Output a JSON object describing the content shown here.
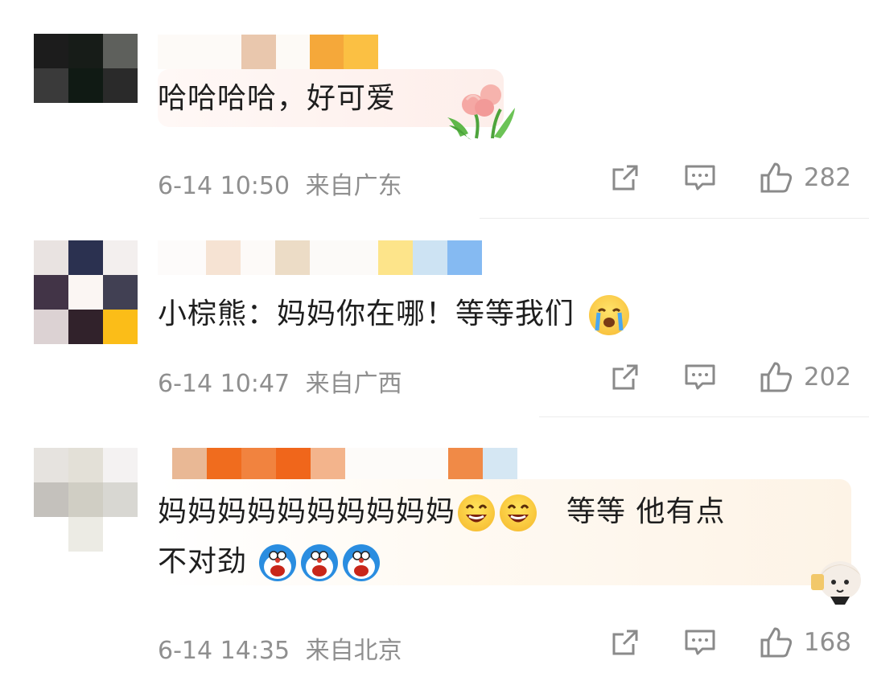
{
  "comments": [
    {
      "text": "哈哈哈哈，好可爱",
      "date": "6-14 10:50",
      "location": "来自广东",
      "likes": "282",
      "sticker": "tulip-sticker"
    },
    {
      "text": "小棕熊：妈妈你在哪！等等我们",
      "date": "6-14 10:47",
      "location": "来自广西",
      "likes": "202",
      "emojis": [
        "crying-face-icon"
      ]
    },
    {
      "text_line1": "妈妈妈妈妈妈妈妈妈妈",
      "text_line1_tail": "等等 他有点",
      "text_line2": "不对劲",
      "date": "6-14 14:35",
      "location": "来自北京",
      "likes": "168",
      "emojis": [
        "grinning-face-icon",
        "grinning-face-icon",
        "doraemon-icon",
        "doraemon-icon",
        "doraemon-icon"
      ],
      "sticker": "anime-girl-sticker"
    }
  ],
  "icons": {
    "repost": "repost-icon",
    "comment": "comment-icon",
    "like": "thumbs-up-icon"
  },
  "colors": {
    "meta_text": "#8f8f8f",
    "body_text": "#1e1e1e",
    "divider": "#ececec"
  }
}
